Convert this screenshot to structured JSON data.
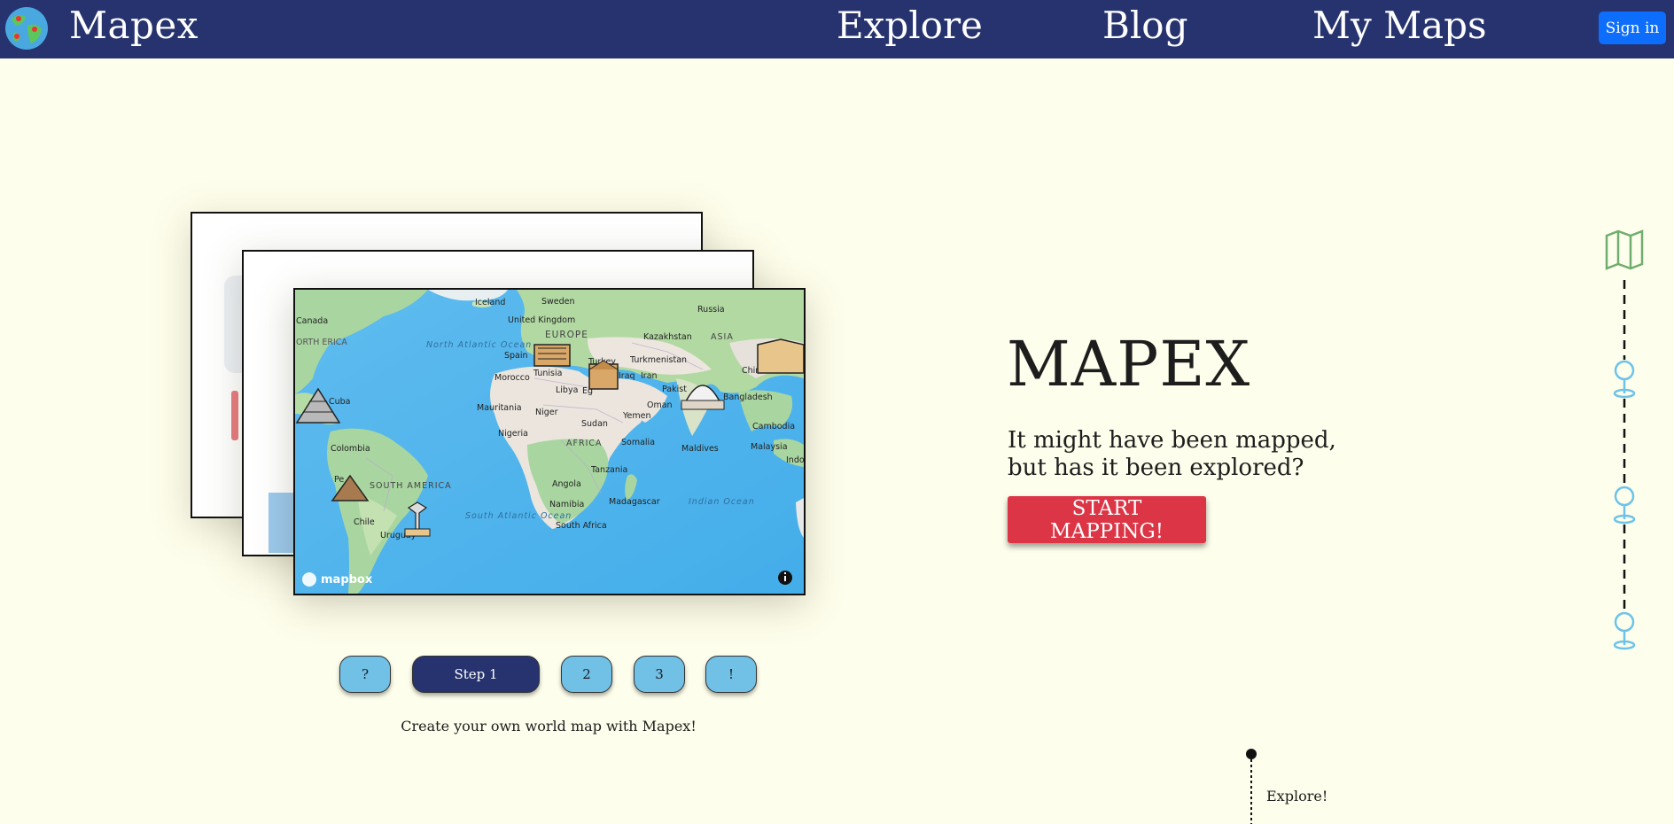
{
  "navbar": {
    "brand": "Mapex",
    "links": [
      "Explore",
      "Blog",
      "My Maps"
    ],
    "signin_label": "Sign in"
  },
  "map_preview": {
    "attribution": "mapbox",
    "labels": [
      "Iceland",
      "Sweden",
      "Russia",
      "United Kingdom",
      "Canada",
      "ORTH ERICA",
      "North Atlantic Ocean",
      "EUROPE",
      "Kazakhstan",
      "ASIA",
      "Spain",
      "Turkey",
      "Turkmenistan",
      "Morocco",
      "Tunisia",
      "Iraq",
      "Iran",
      "Chin",
      "Cuba",
      "Libya",
      "Eg",
      "Pakist",
      "Oman",
      "Mauritania",
      "Niger",
      "Yemen",
      "Bangladesh",
      "Sudan",
      "Cambodia",
      "Nigeria",
      "AFRICA",
      "Somalia",
      "Malaysia",
      "Colombia",
      "Maldives",
      "Indo",
      "Tanzania",
      "Pe",
      "SOUTH AMERICA",
      "Angola",
      "Madagascar",
      "Indian Ocean",
      "Namibia",
      "Chile",
      "South Atlantic Ocean",
      "South Africa",
      "Uruguay"
    ]
  },
  "steps": [
    "?",
    "Step 1",
    "2",
    "3",
    "!"
  ],
  "active_step": "Step 1",
  "caption": "Create your own world map with Mapex!",
  "hero": {
    "title": "MAPEX",
    "line1": "It might have been mapped,",
    "line2": "but has it been explored?",
    "cta": "START MAPPING!"
  },
  "timeline": {
    "explore_label": "Explore!"
  },
  "colors": {
    "navbar": "#26336e",
    "background": "#fefeec",
    "cta": "#dc3545",
    "step": "#71c0e6",
    "signin": "#0d6efd",
    "ocean": "#4fb4ec",
    "land": "#a9d6a0"
  },
  "icons": [
    "globe-logo-icon",
    "map-icon",
    "location-pin-icon",
    "info-icon",
    "mapbox-logo-icon",
    "landmark-icon"
  ]
}
